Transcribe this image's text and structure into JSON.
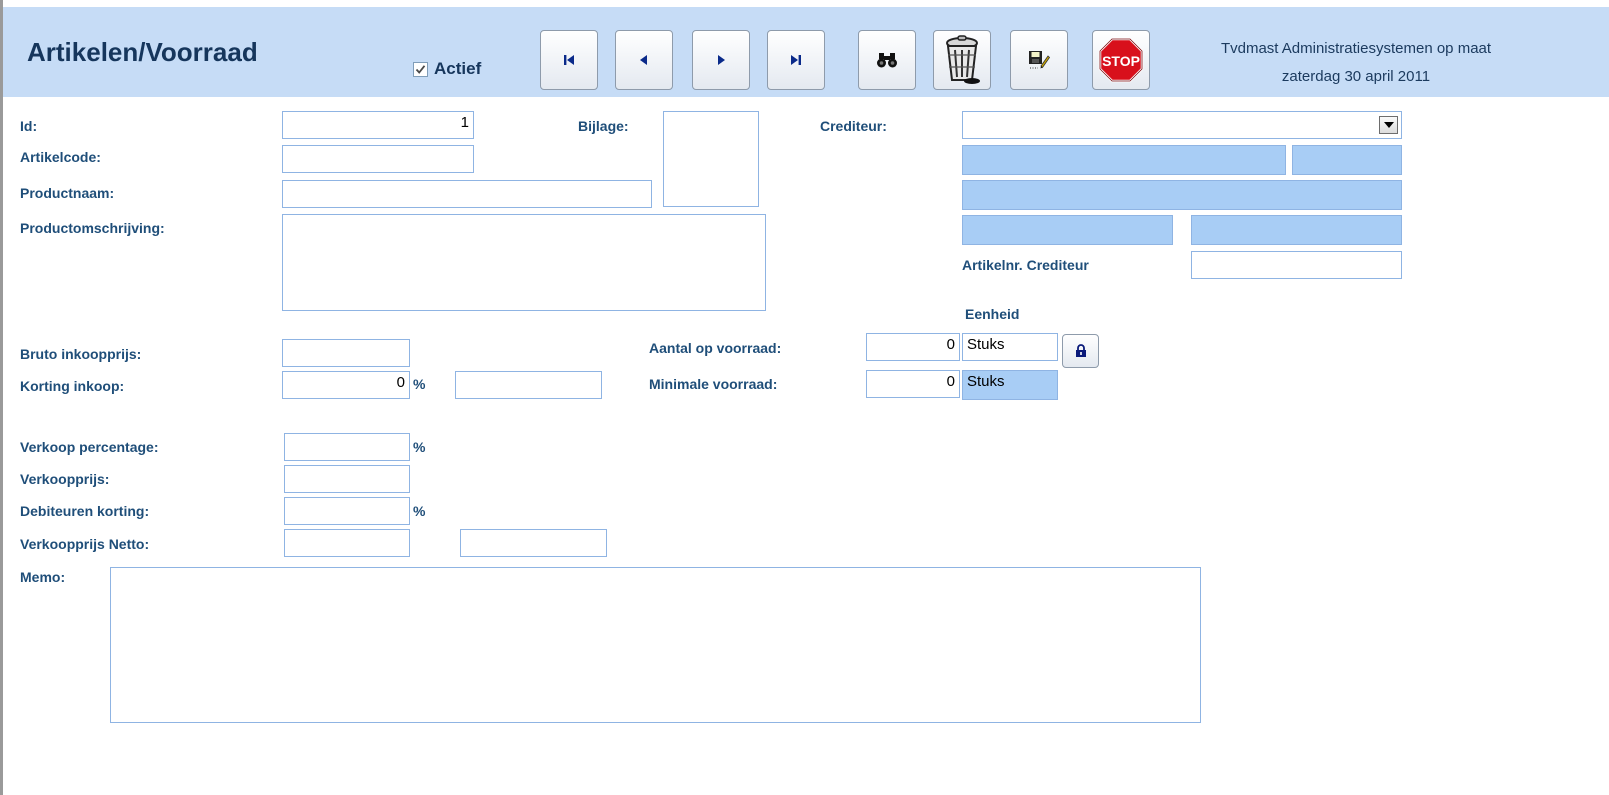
{
  "header": {
    "title": "Artikelen/Voorraad",
    "actief_label": "Actief",
    "actief_checked": true,
    "company": "Tvdmast Administratiesystemen op maat",
    "date": "zaterdag 30 april 2011"
  },
  "toolbar": {
    "first_icon": "first-record-icon",
    "prev_icon": "previous-record-icon",
    "next_icon": "next-record-icon",
    "last_icon": "last-record-icon",
    "search_icon": "binoculars-icon",
    "delete_icon": "trash-can-icon",
    "save_icon": "save-icon",
    "stop_icon": "stop-sign-icon",
    "stop_text": "STOP"
  },
  "labels": {
    "id": "Id:",
    "artikelcode": "Artikelcode:",
    "productnaam": "Productnaam:",
    "productomschrijving": "Productomschrijving:",
    "bijlage": "Bijlage:",
    "crediteur": "Crediteur:",
    "artikelnr_crediteur": "Artikelnr. Crediteur",
    "eenheid": "Eenheid",
    "aantal_op_voorraad": "Aantal op voorraad:",
    "minimale_voorraad": "Minimale voorraad:",
    "bruto_inkoopprijs": "Bruto inkoopprijs:",
    "korting_inkoop": "Korting inkoop:",
    "verkoop_percentage": "Verkoop percentage:",
    "verkoopprijs": "Verkoopprijs:",
    "debiteuren_korting": "Debiteuren korting:",
    "verkoopprijs_netto": "Verkoopprijs Netto:",
    "memo": "Memo:",
    "percent": "%"
  },
  "fields": {
    "id": "1",
    "artikelcode": "",
    "productnaam": "",
    "productomschrijving": "",
    "crediteur": "",
    "artikelnr_crediteur": "",
    "aantal_op_voorraad": "0",
    "aantal_eenheid": "Stuks",
    "minimale_voorraad": "0",
    "minimale_eenheid": "Stuks",
    "bruto_inkoopprijs": "",
    "korting_inkoop": "0",
    "korting_inkoop_bedrag": "",
    "verkoop_percentage": "",
    "verkoopprijs": "",
    "debiteuren_korting": "",
    "verkoopprijs_netto": "",
    "verkoopprijs_netto_extra": "",
    "memo": ""
  },
  "colors": {
    "header_bg": "#c6dcf6",
    "label_text": "#1f4e79",
    "field_border": "#8fb4e3",
    "readonly_field_bg": "#a8cdf5"
  }
}
